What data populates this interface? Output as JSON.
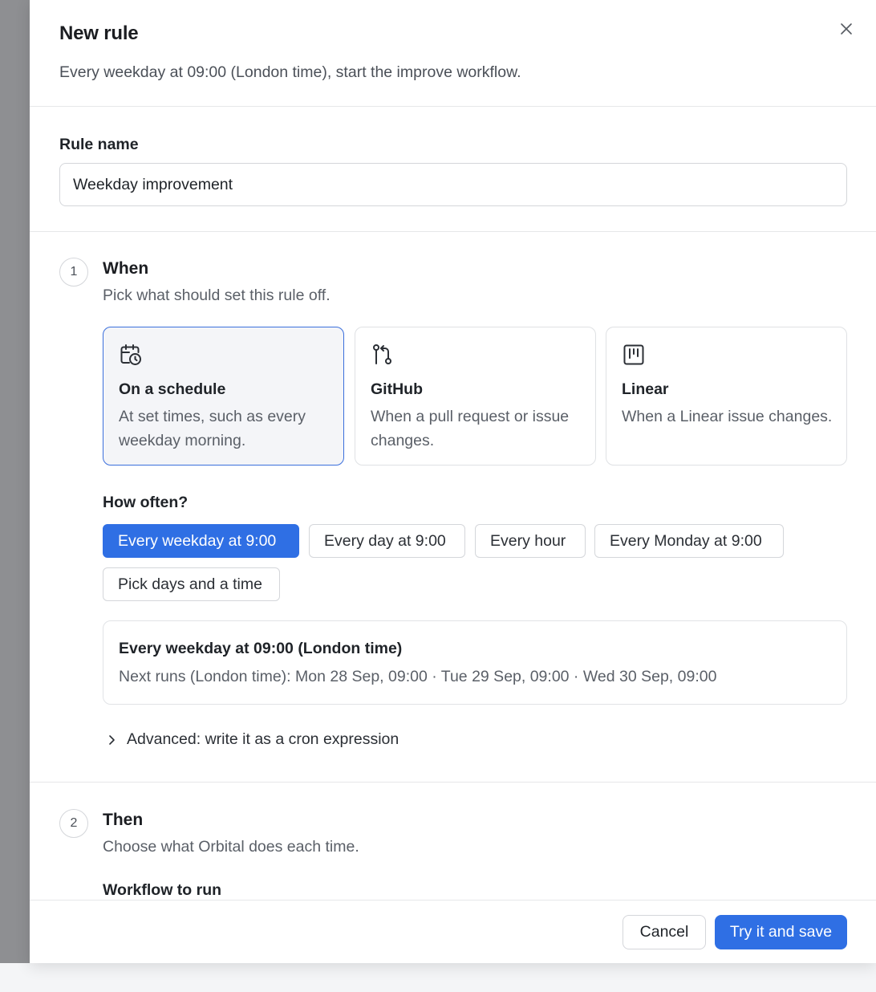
{
  "dialog": {
    "title": "New rule",
    "subtitle": "Every weekday at 09:00 (London time), start the improve workflow."
  },
  "rule_name": {
    "label": "Rule name",
    "value": "Weekday improvement"
  },
  "when": {
    "number": "1",
    "title": "When",
    "description": "Pick what should set this rule off.",
    "triggers": [
      {
        "icon": "calendar-clock-icon",
        "name": "On a schedule",
        "description": "At set times, such as every weekday morning.",
        "selected": true
      },
      {
        "icon": "git-pull-request-icon",
        "name": "GitHub",
        "description": "When a pull request or issue changes.",
        "selected": false
      },
      {
        "icon": "linear-board-icon",
        "name": "Linear",
        "description": "When a Linear issue changes.",
        "selected": false
      }
    ],
    "frequency": {
      "label": "How often?",
      "options": [
        {
          "label": "Every weekday at 9:00",
          "active": true
        },
        {
          "label": "Every day at 9:00",
          "active": false
        },
        {
          "label": "Every hour",
          "active": false
        },
        {
          "label": "Every Monday at 9:00",
          "active": false
        },
        {
          "label": "Pick days and a time",
          "active": false
        }
      ]
    },
    "summary": {
      "title": "Every weekday at 09:00 (London time)",
      "next_runs": "Next runs (London time): Mon 28 Sep, 09:00 · Tue 29 Sep, 09:00 · Wed 30 Sep, 09:00"
    },
    "advanced_label": "Advanced: write it as a cron expression"
  },
  "then": {
    "number": "2",
    "title": "Then",
    "description": "Choose what Orbital does each time.",
    "workflow_label": "Workflow to run"
  },
  "footer": {
    "cancel_label": "Cancel",
    "save_label": "Try it and save"
  },
  "colors": {
    "accent": "#2f6fe4",
    "selected_border": "#3b6fdc",
    "backdrop": "#8e8f92"
  }
}
